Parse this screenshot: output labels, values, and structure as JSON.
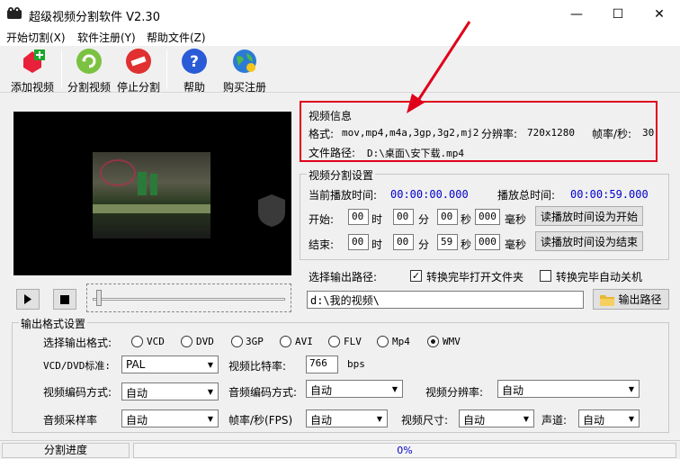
{
  "window": {
    "title": "超级视频分割软件 V2.30",
    "minimize": "—",
    "maximize": "☐",
    "close": "✕"
  },
  "menu": [
    "开始切割(X)",
    "软件注册(Y)",
    "帮助文件(Z)"
  ],
  "toolbar": {
    "add_video": "添加视频",
    "split_video": "分割视频",
    "stop_split": "停止分割",
    "help": "帮助",
    "buy": "购买注册"
  },
  "video_info": {
    "title": "视频信息",
    "format_label": "格式:",
    "format_value": "mov,mp4,m4a,3gp,3g2,mj2",
    "resolution_label": "分辨率:",
    "resolution_value": "720x1280",
    "fps_label": "帧率/秒:",
    "fps_value": "30",
    "path_label": "文件路径:",
    "path_value": "D:\\桌面\\安下载.mp4"
  },
  "split_settings": {
    "title": "视频分割设置",
    "current_label": "当前播放时间:",
    "current_value": "00:00:00.000",
    "total_label": "播放总时间:",
    "total_value": "00:00:59.000",
    "start_label": "开始:",
    "end_label": "结束:",
    "unit_hour": "时",
    "unit_min": "分",
    "unit_sec": "秒",
    "unit_ms": "毫秒",
    "start": {
      "h": "00",
      "m": "00",
      "s": "00",
      "ms": "000"
    },
    "end": {
      "h": "00",
      "m": "00",
      "s": "59",
      "ms": "000"
    },
    "set_start_btn": "读播放时间设为开始",
    "set_end_btn": "读播放时间设为结束"
  },
  "output": {
    "path_label": "选择输出路径:",
    "open_folder_label": "转换完毕打开文件夹",
    "open_folder_checked": true,
    "shutdown_label": "转换完毕自动关机",
    "shutdown_checked": false,
    "path_value": "d:\\我的视频\\",
    "output_btn": "输出路径"
  },
  "format_settings": {
    "title": "输出格式设置",
    "select_label": "选择输出格式:",
    "formats": [
      "VCD",
      "DVD",
      "3GP",
      "AVI",
      "FLV",
      "Mp4",
      "WMV"
    ],
    "selected_format": "WMV",
    "vcd_std_label": "VCD/DVD标准:",
    "vcd_std_value": "PAL",
    "bitrate_label": "视频比特率:",
    "bitrate_value": "766",
    "bitrate_unit": "bps",
    "vcodec_label": "视频编码方式:",
    "vcodec_value": "自动",
    "acodec_label": "音频编码方式:",
    "acodec_value": "自动",
    "vres_label": "视频分辨率:",
    "vres_value": "自动",
    "asample_label": "音频采样率",
    "asample_value": "自动",
    "fps_label": "帧率/秒(FPS)",
    "fps_value": "自动",
    "vsize_label": "视频尺寸:",
    "vsize_value": "自动",
    "channel_label": "声道:",
    "channel_value": "自动"
  },
  "status": {
    "label": "分割进度",
    "progress_text": "0%",
    "progress": 0
  },
  "colors": {
    "highlight": "#e0001a",
    "arrow": "#e0001a",
    "blue_time": "#0000cc"
  }
}
